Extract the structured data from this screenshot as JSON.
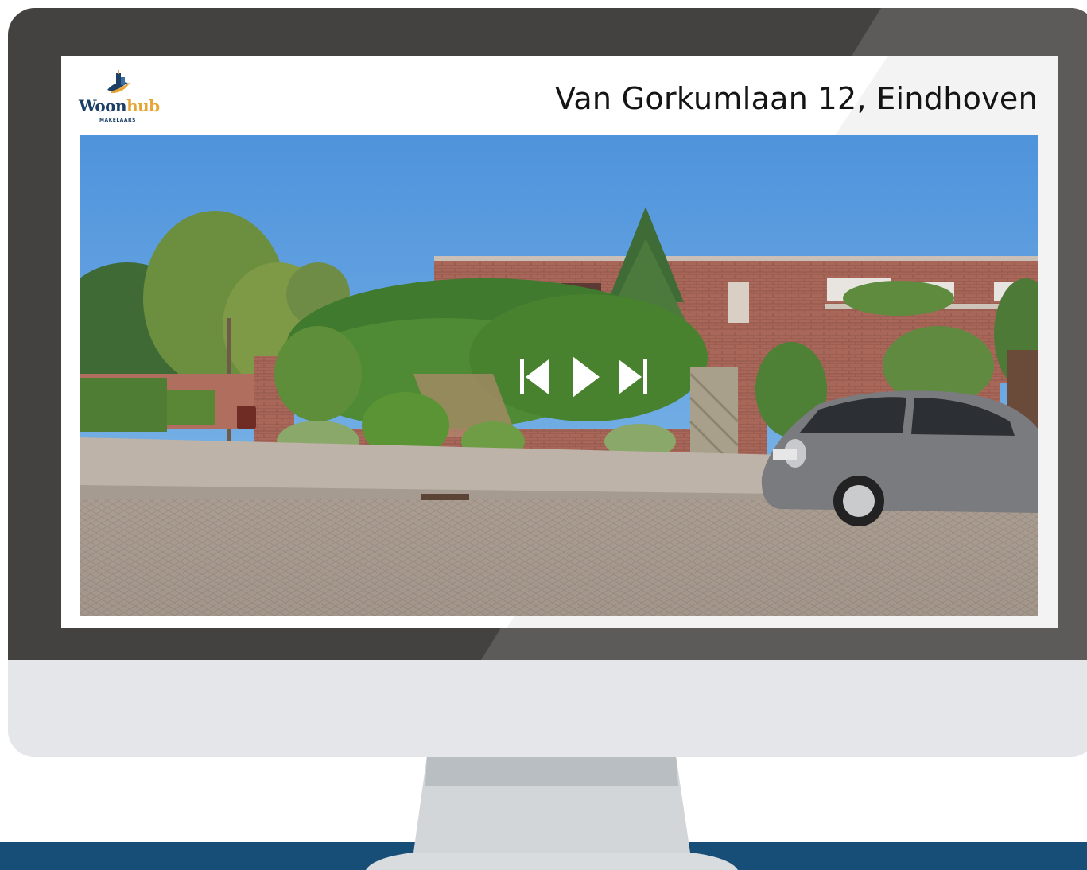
{
  "brand": {
    "name_part1": "Woon",
    "name_part2": "hub",
    "tagline": "MAKELAARS",
    "icon": "house-logo-icon",
    "colors": {
      "navy": "#1c3f66",
      "gold": "#e7a536"
    }
  },
  "listing": {
    "title": "Van Gorkumlaan 12, Eindhoven"
  },
  "slideshow": {
    "controls": {
      "previous_icon": "skip-previous-icon",
      "play_icon": "play-icon",
      "next_icon": "skip-next-icon"
    }
  },
  "theme": {
    "bezel": "#434241",
    "chin": "#e5e6e9",
    "band": "#174e78"
  }
}
